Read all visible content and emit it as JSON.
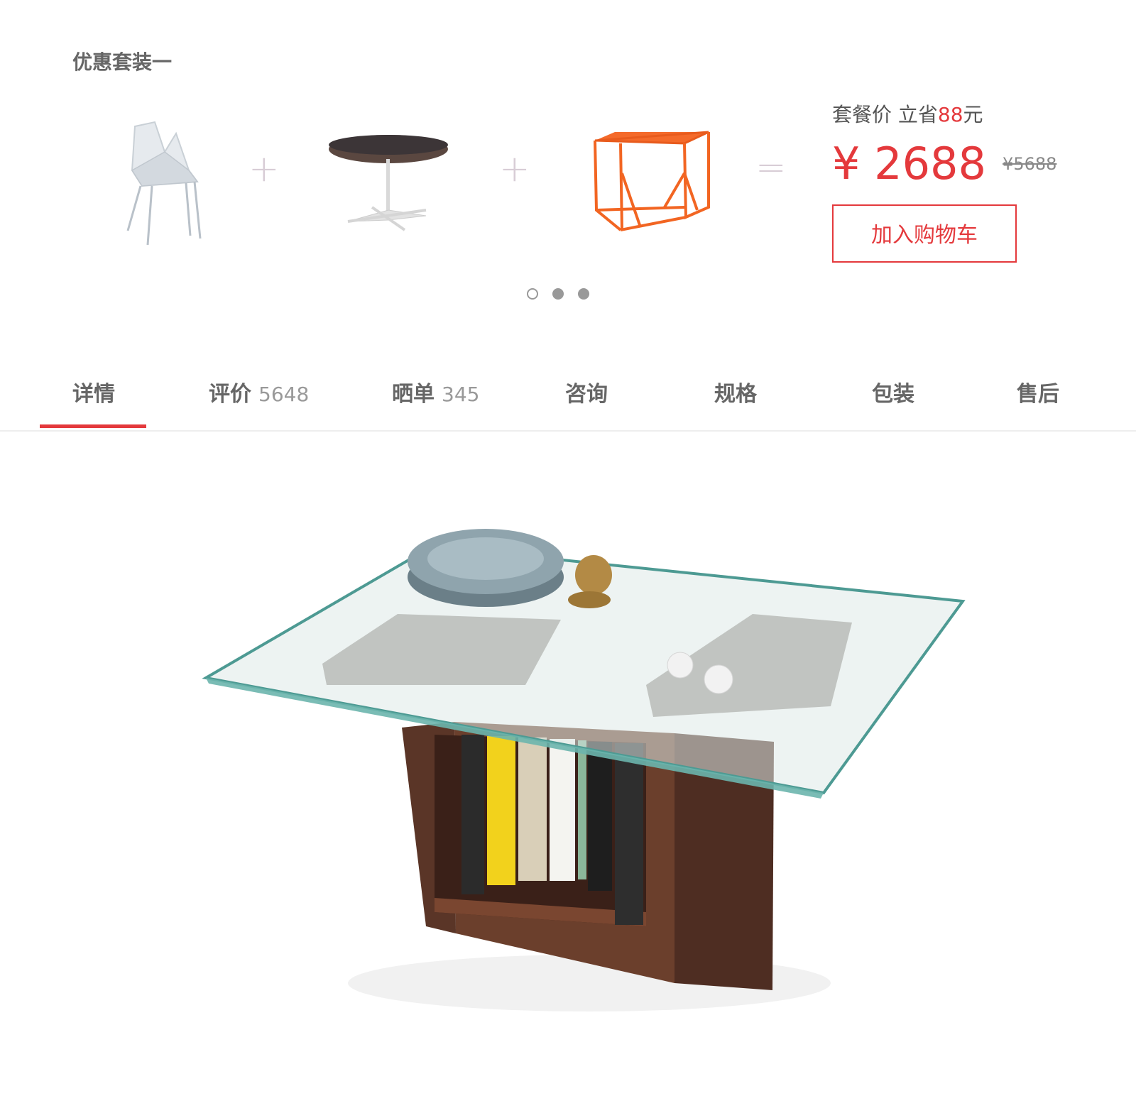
{
  "bundle": {
    "title": "优惠套装一",
    "products": [
      {
        "name": "chair",
        "icon": "white-chair"
      },
      {
        "name": "round-table",
        "icon": "round-cafe-table"
      },
      {
        "name": "side-table",
        "icon": "orange-wire-side-table"
      }
    ],
    "operators": [
      "+",
      "+",
      "="
    ],
    "price_label": "套餐价  立省",
    "save_amount": "88",
    "save_unit": "元",
    "price": "¥ 2688",
    "original_price": "¥5688",
    "cart_button": "加入购物车"
  },
  "carousel": {
    "dot_count": 3,
    "active_index": 0
  },
  "tabs": [
    {
      "label": "详情",
      "count": ""
    },
    {
      "label": "评价",
      "count": "5648"
    },
    {
      "label": "晒单",
      "count": "345"
    },
    {
      "label": "咨询",
      "count": ""
    },
    {
      "label": "规格",
      "count": ""
    },
    {
      "label": "包装",
      "count": ""
    },
    {
      "label": "售后",
      "count": ""
    }
  ],
  "active_tab": 0,
  "colors": {
    "accent": "#e4393c",
    "operator": "#d8cdd6",
    "text": "#666666"
  },
  "hero": {
    "icon": "glass-coffee-table-with-books"
  }
}
